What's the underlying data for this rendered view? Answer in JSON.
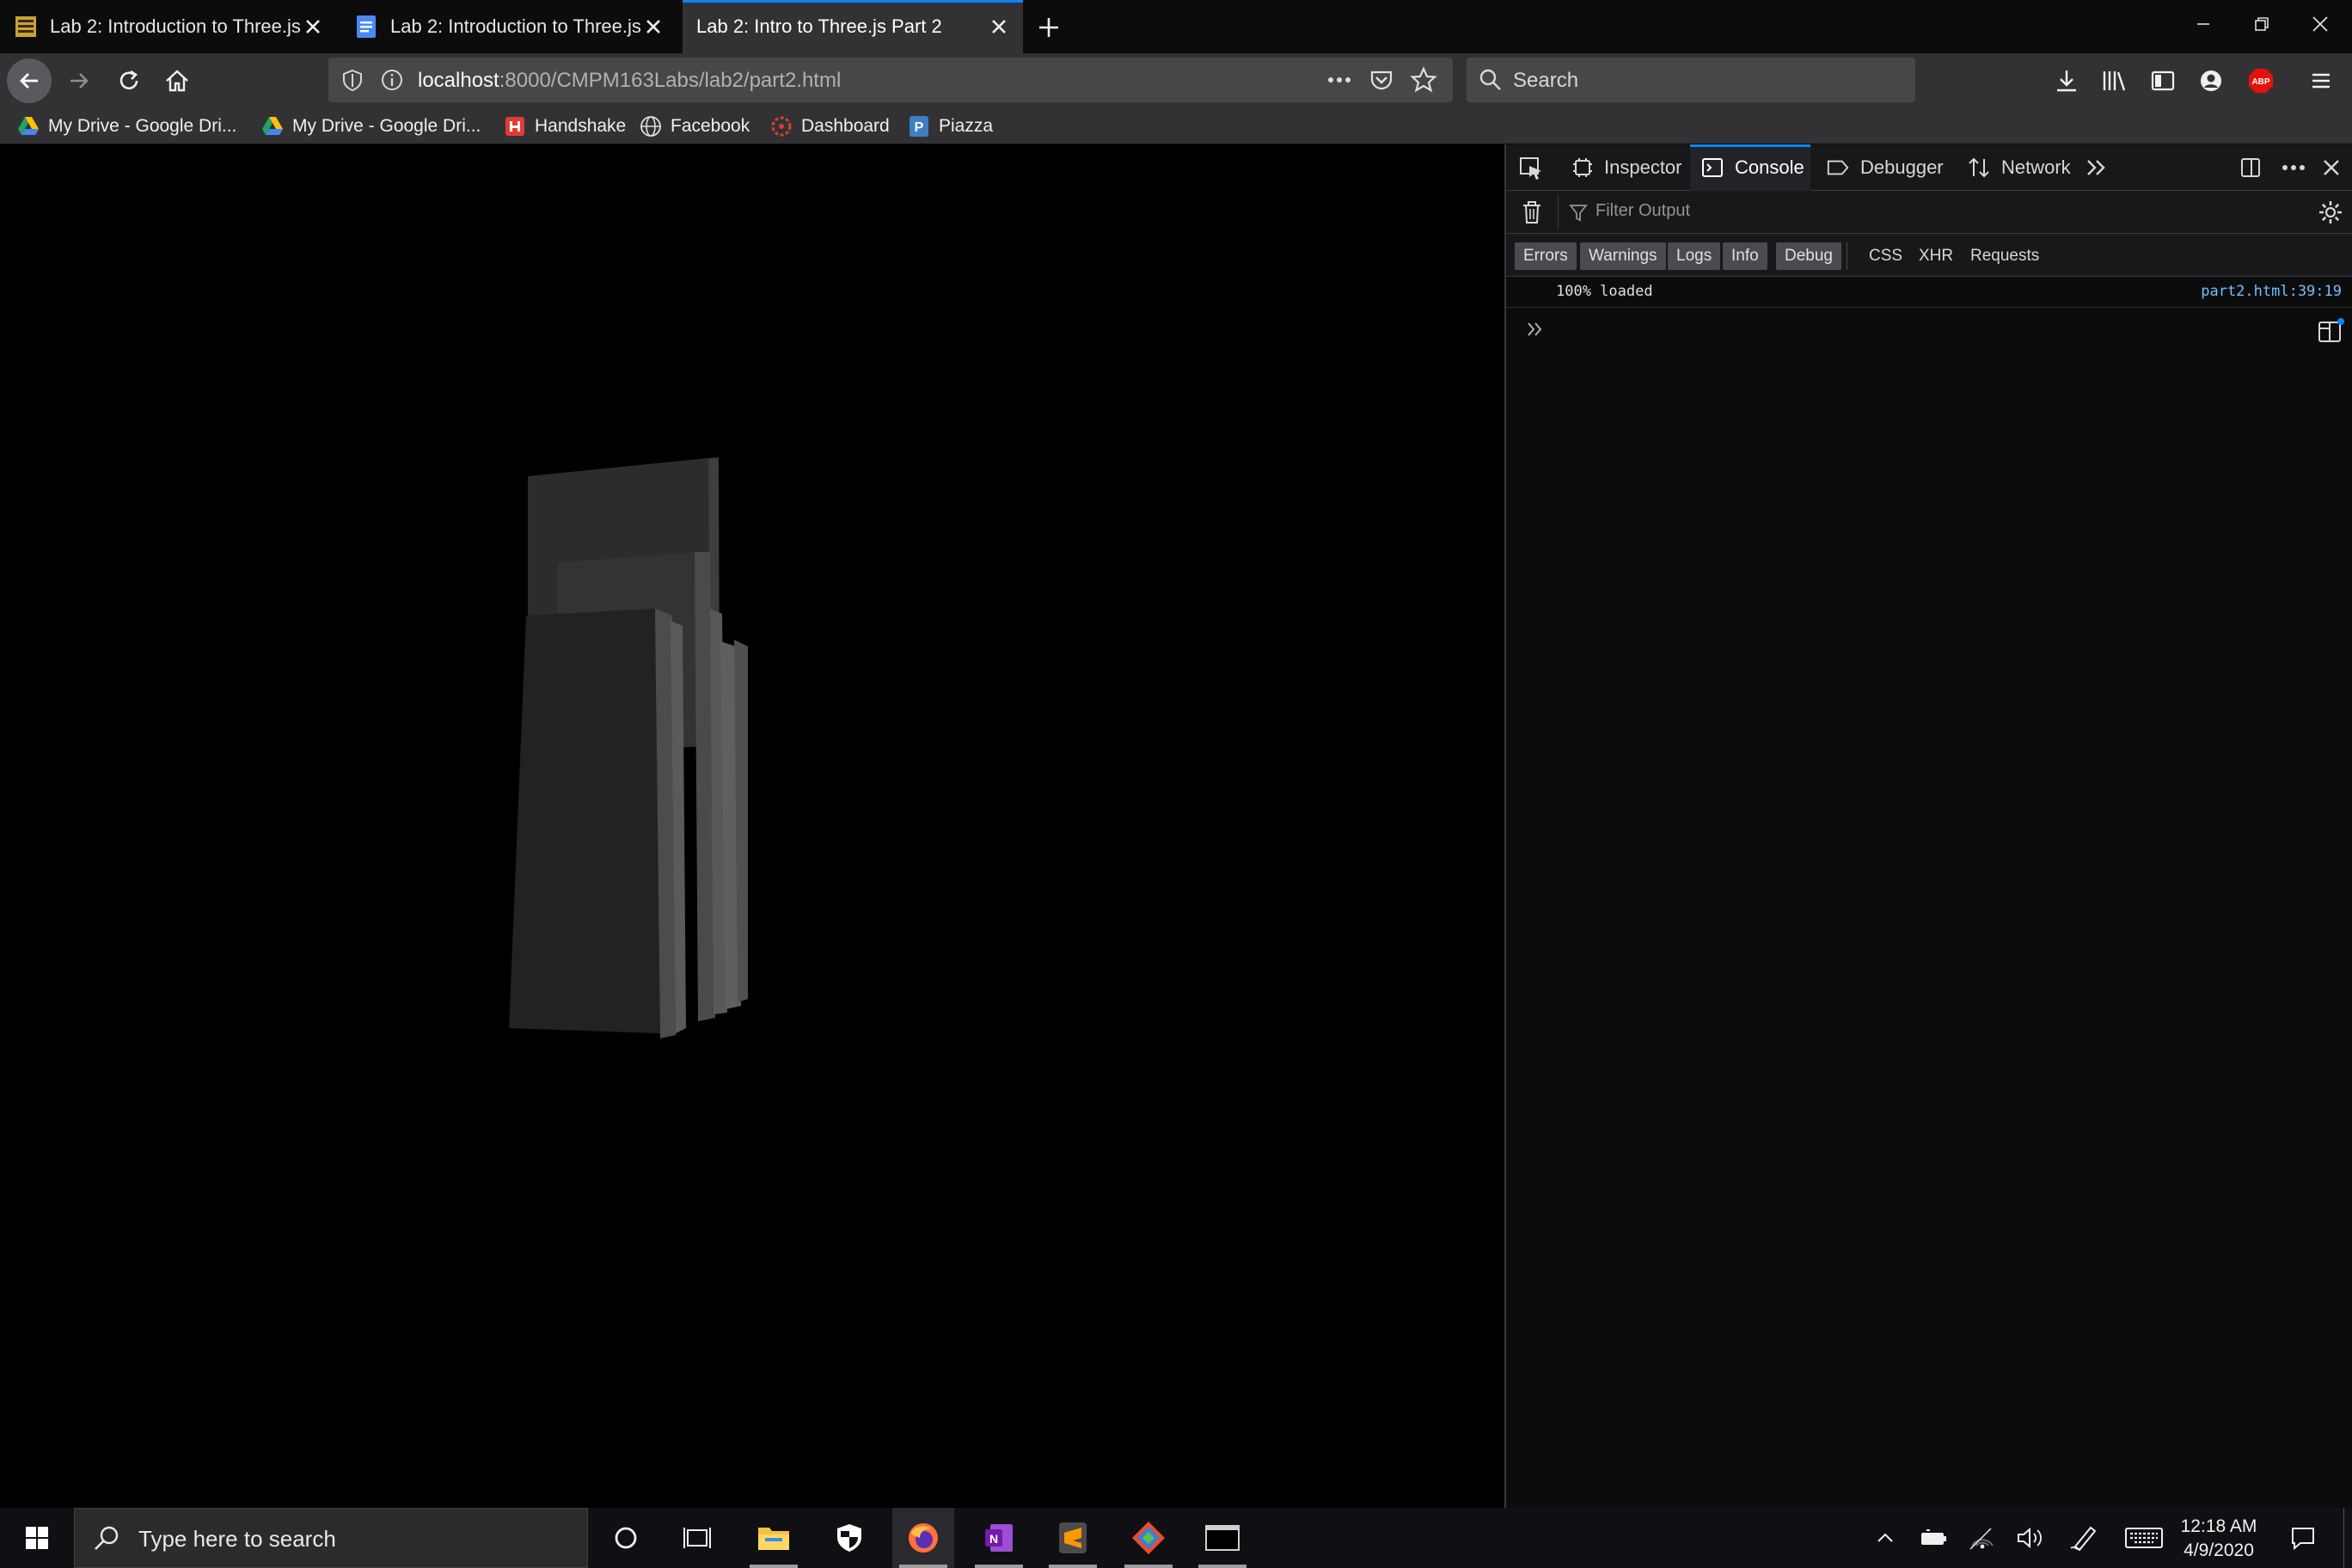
{
  "browser": {
    "tabs": [
      {
        "title": "Lab 2: Introduction to Three.js",
        "favicon": "cmpm-icon",
        "active": false
      },
      {
        "title": "Lab 2: Introduction to Three.js",
        "favicon": "google-docs-icon",
        "active": false
      },
      {
        "title": "Lab 2: Intro to Three.js Part 2",
        "favicon": "",
        "active": true
      }
    ],
    "new_tab_icon": "plus-icon",
    "window_controls": [
      "minimize-icon",
      "restore-icon",
      "close-icon"
    ],
    "nav": {
      "back_icon": "arrow-left-icon",
      "forward_icon": "arrow-right-icon",
      "reload_icon": "reload-icon",
      "home_icon": "home-icon"
    },
    "url": {
      "host": "localhost",
      "rest": ":8000/CMPM163Labs/lab2/part2.html"
    },
    "search_placeholder": "Search",
    "toolbar_icons": [
      "download-icon",
      "library-icon",
      "sidebar-icon",
      "account-icon",
      "adblock-icon",
      "menu-icon"
    ],
    "bookmarks": [
      {
        "label": "My Drive - Google Dri...",
        "icon": "google-drive-icon"
      },
      {
        "label": "My Drive - Google Dri...",
        "icon": "google-drive-icon"
      },
      {
        "label": "Handshake",
        "icon": "handshake-icon"
      },
      {
        "label": "Facebook",
        "icon": "globe-icon"
      },
      {
        "label": "Dashboard",
        "icon": "dashboard-icon"
      },
      {
        "label": "Piazza",
        "icon": "piazza-icon"
      }
    ]
  },
  "devtools": {
    "tabs": [
      {
        "label": "Inspector",
        "icon": "inspector-icon"
      },
      {
        "label": "Console",
        "icon": "console-icon",
        "selected": true
      },
      {
        "label": "Debugger",
        "icon": "debugger-icon"
      },
      {
        "label": "Network",
        "icon": "network-icon"
      }
    ],
    "filter_placeholder": "Filter Output",
    "levels": [
      "Errors",
      "Warnings",
      "Logs",
      "Info",
      "Debug"
    ],
    "categories": [
      "CSS",
      "XHR",
      "Requests"
    ],
    "message": {
      "text": "100% loaded",
      "source": "part2.html:39:19"
    }
  },
  "taskbar": {
    "search_placeholder": "Type here to search",
    "apps": [
      "file-explorer-icon",
      "security-icon",
      "firefox-icon",
      "onenote-icon",
      "sublime-text-icon",
      "git-icon",
      "terminal-icon"
    ],
    "clock": {
      "time": "12:18 AM",
      "date": "4/9/2020"
    }
  },
  "colors": {
    "accent": "#0a84ff",
    "chrome_dark": "#0c0c0d",
    "toolbar": "#323234"
  }
}
